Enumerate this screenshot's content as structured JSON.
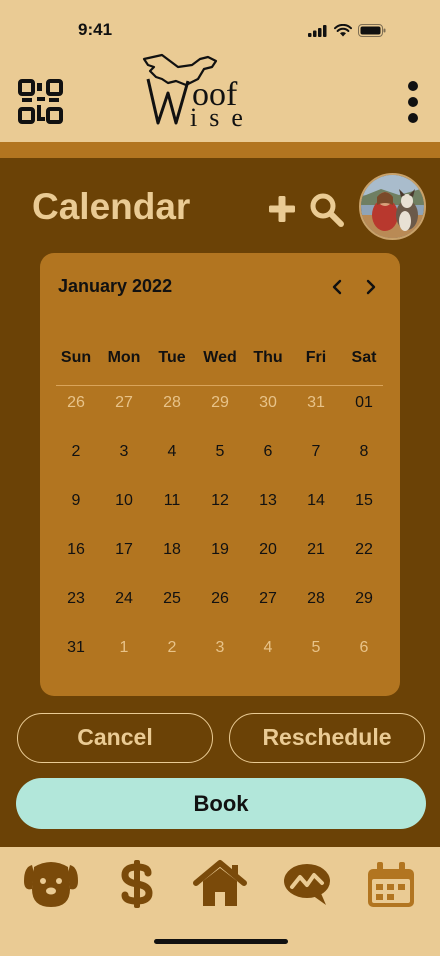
{
  "status_bar": {
    "time": "9:41"
  },
  "header": {
    "logo": {
      "line1": "oof",
      "line2": "ise",
      "alt": "Woof Wise"
    },
    "icons": {
      "qr": "qr-code-icon",
      "more": "more-vertical-icon"
    }
  },
  "page": {
    "title": "Calendar",
    "icons": {
      "add": "plus-icon",
      "search": "search-icon",
      "avatar": "avatar"
    }
  },
  "calendar": {
    "month_label": "January 2022",
    "weekdays": [
      "Sun",
      "Mon",
      "Tue",
      "Wed",
      "Thu",
      "Fri",
      "Sat"
    ],
    "weeks": [
      [
        {
          "d": "26",
          "m": true
        },
        {
          "d": "27",
          "m": true
        },
        {
          "d": "28",
          "m": true
        },
        {
          "d": "29",
          "m": true
        },
        {
          "d": "30",
          "m": true
        },
        {
          "d": "31",
          "m": true
        },
        {
          "d": "01",
          "m": false
        }
      ],
      [
        {
          "d": "2",
          "m": false
        },
        {
          "d": "3",
          "m": false
        },
        {
          "d": "4",
          "m": false
        },
        {
          "d": "5",
          "m": false
        },
        {
          "d": "6",
          "m": false
        },
        {
          "d": "7",
          "m": false
        },
        {
          "d": "8",
          "m": false
        }
      ],
      [
        {
          "d": "9",
          "m": false
        },
        {
          "d": "10",
          "m": false
        },
        {
          "d": "11",
          "m": false
        },
        {
          "d": "12",
          "m": false
        },
        {
          "d": "13",
          "m": false
        },
        {
          "d": "14",
          "m": false
        },
        {
          "d": "15",
          "m": false
        }
      ],
      [
        {
          "d": "16",
          "m": false
        },
        {
          "d": "17",
          "m": false
        },
        {
          "d": "18",
          "m": false
        },
        {
          "d": "19",
          "m": false
        },
        {
          "d": "20",
          "m": false
        },
        {
          "d": "21",
          "m": false
        },
        {
          "d": "22",
          "m": false
        }
      ],
      [
        {
          "d": "23",
          "m": false
        },
        {
          "d": "24",
          "m": false
        },
        {
          "d": "25",
          "m": false
        },
        {
          "d": "26",
          "m": false
        },
        {
          "d": "27",
          "m": false
        },
        {
          "d": "28",
          "m": false
        },
        {
          "d": "29",
          "m": false
        }
      ],
      [
        {
          "d": "31",
          "m": false
        },
        {
          "d": "1",
          "m": true
        },
        {
          "d": "2",
          "m": true
        },
        {
          "d": "3",
          "m": true
        },
        {
          "d": "4",
          "m": true
        },
        {
          "d": "5",
          "m": true
        },
        {
          "d": "6",
          "m": true
        }
      ]
    ]
  },
  "actions": {
    "cancel_label": "Cancel",
    "reschedule_label": "Reschedule",
    "book_label": "Book"
  },
  "tab_bar": {
    "tabs": [
      "dog-icon",
      "dollar-icon",
      "home-icon",
      "chat-icon",
      "calendar-icon"
    ]
  },
  "colors": {
    "background": "#6b4206",
    "header": "#eacb94",
    "accent": "#b27520",
    "book_button": "#b2e7da",
    "muted_day": "#e8c389"
  }
}
